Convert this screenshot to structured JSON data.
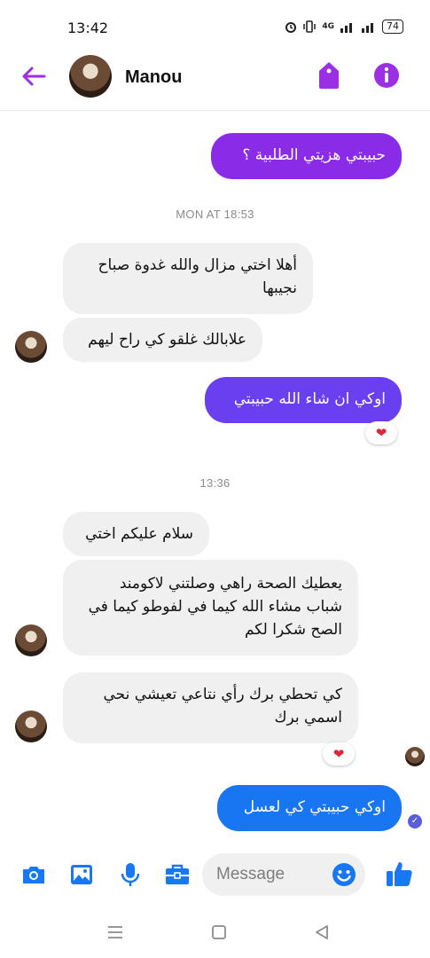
{
  "status_bar": {
    "time": "13:42",
    "network": "4G",
    "battery": "74"
  },
  "header": {
    "contact_name": "Manou"
  },
  "colors": {
    "accent": "#9b2fe4",
    "bubble_purple": "#8a2be8",
    "bubble_blue_purple": "#6a3ff0",
    "bubble_blue": "#1976f2",
    "incoming_bubble": "#f0f0f0"
  },
  "messages": {
    "m1": "حبيبتي هزيتي الطلبية ؟",
    "stamp1": "MON AT 18:53",
    "m2": "أهلا اختي مزال والله غدوة صباح نجيبها",
    "m3": "علابالك غلقو كي راح ليهم",
    "m4": "اوكي ان شاء الله حبيبتي",
    "m4_reaction": "❤",
    "stamp2": "13:36",
    "m5": "سلام عليكم اختي",
    "m6": "يعطيك الصحة راهي وصلتني لاكومند شباب مشاء الله كيما في لفوطو كيما في الصح شكرا لكم",
    "m7": "كي تحطي برك رأي نتاعي تعيشي نحي اسمي برك",
    "m7_reaction": "❤",
    "m8": "اوكي حبيبتي كي لعسل"
  },
  "composer": {
    "placeholder": "Message"
  },
  "icons": [
    "back-arrow-icon",
    "tag-icon",
    "info-icon",
    "camera-icon",
    "image-icon",
    "microphone-icon",
    "briefcase-icon",
    "emoji-icon",
    "thumbs-up-icon",
    "menu-icon",
    "square-icon",
    "triangle-back-icon"
  ]
}
